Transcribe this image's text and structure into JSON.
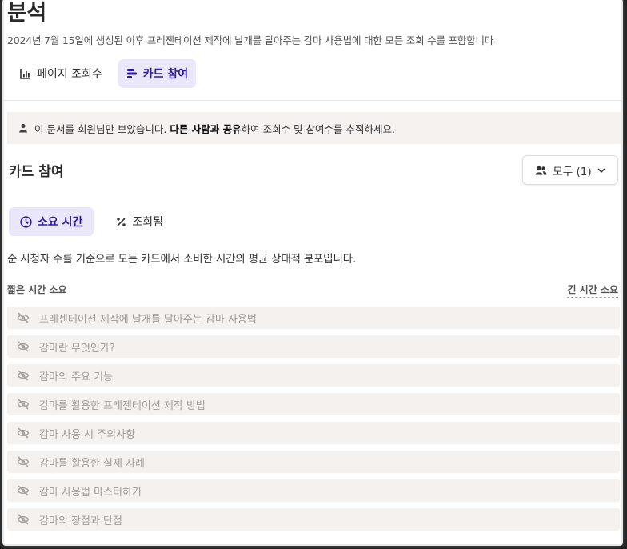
{
  "page": {
    "title": "분석",
    "subtitle": "2024년 7월 15일에 생성된 이후 프레젠테이션 제작에 날개를 달아주는 감마 사용법에 대한 모든 조회 수를 포함합니다"
  },
  "tabs": [
    {
      "label": "페이지 조회수",
      "icon": "bar-chart-icon",
      "active": false
    },
    {
      "label": "카드 참여",
      "icon": "card-engagement-icon",
      "active": true
    }
  ],
  "notice": {
    "prefix": "이 문서를 회원님만 보았습니다. ",
    "link": "다른 사람과 공유",
    "suffix": "하여 조회수 및 참여수를 추적하세요."
  },
  "section": {
    "title": "카드 참여",
    "filter_label": "모두 (1)"
  },
  "subtabs": [
    {
      "label": "소요 시간",
      "icon": "clock-icon",
      "active": true
    },
    {
      "label": "조회됨",
      "icon": "percent-icon",
      "active": false
    }
  ],
  "description": "순 시청자 수를 기준으로 모든 카드에서 소비한 시간의 평균 상대적 분포입니다.",
  "axis": {
    "left": "짧은 시간 소요",
    "right": "긴 시간 소요"
  },
  "cards": [
    "프레젠테이션 제작에 날개를 달아주는 감마 사용법",
    "감마란 무엇인가?",
    "감마의 주요 기능",
    "감마를 활용한 프레젠테이션 제작 방법",
    "감마 사용 시 주의사항",
    "감마를 활용한 실제 사례",
    "감마 사용법 마스터하기",
    "감마의 장점과 단점"
  ],
  "colors": {
    "accent": "#2d1a9e",
    "accent_bg": "#ebe7fb",
    "row_bg": "#f5f1ef"
  }
}
